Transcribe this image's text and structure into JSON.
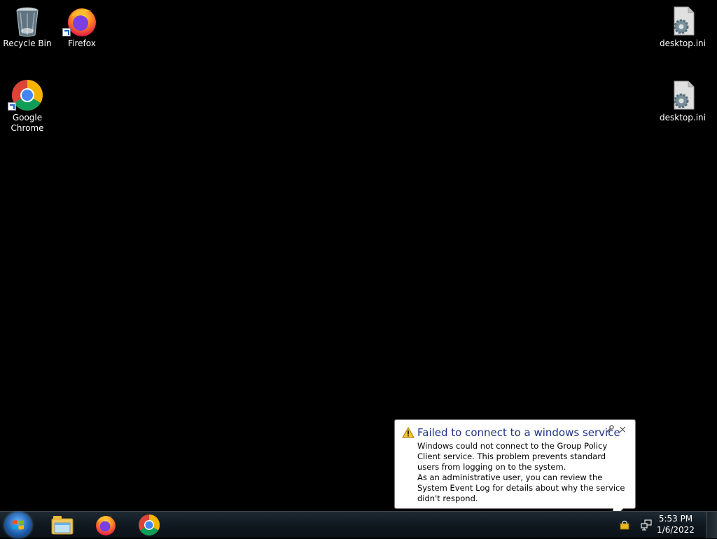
{
  "desktop": {
    "icons": [
      {
        "label": "Recycle Bin",
        "icon": "recycle-bin-icon"
      },
      {
        "label": "Firefox",
        "icon": "firefox-icon"
      },
      {
        "label": "Google\nChrome",
        "icon": "chrome-icon"
      },
      {
        "label": "desktop.ini",
        "icon": "settings-file-icon"
      },
      {
        "label": "desktop.ini",
        "icon": "settings-file-icon"
      }
    ]
  },
  "balloon": {
    "title": "Failed to connect to a windows service",
    "body_1": "Windows could not connect to the Group Policy Client service. This problem prevents standard users from logging on to the system.",
    "body_2": "As an administrative user, you can review the System Event Log for details about why the service didn't respond.",
    "close": "×",
    "icon": "warning-icon"
  },
  "taskbar": {
    "start_icon": "windows-start-icon",
    "pinned": [
      "file-explorer-icon",
      "firefox-icon",
      "chrome-icon"
    ],
    "tray": [
      "action-center-icon",
      "network-icon"
    ],
    "time": "5:53 PM",
    "date": "1/6/2022"
  },
  "colors": {
    "desktop_bg": "#000000",
    "balloon_title": "#1e3287"
  }
}
